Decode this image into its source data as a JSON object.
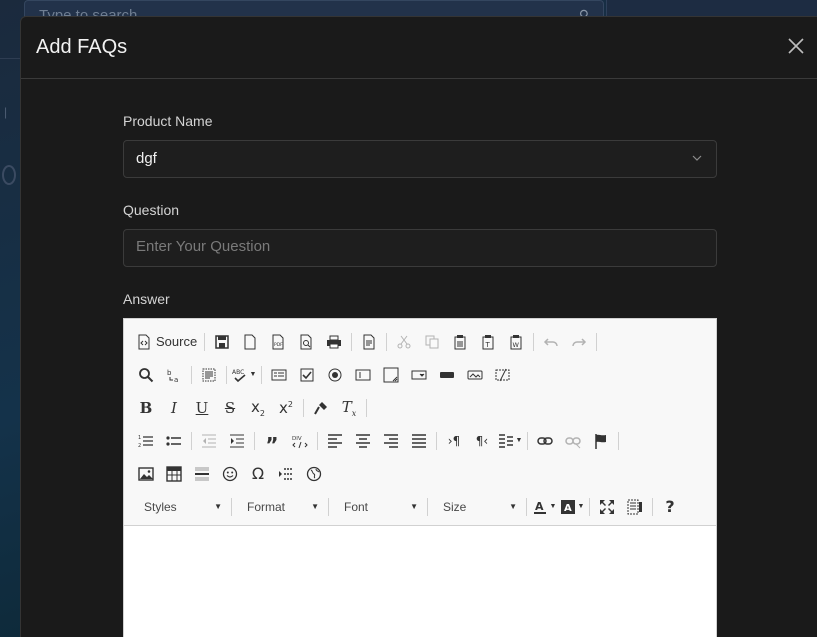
{
  "background": {
    "search_placeholder": "Type to search"
  },
  "modal": {
    "title": "Add FAQs",
    "close_symbol": "×"
  },
  "form": {
    "product_label": "Product Name",
    "product_value": "dgf",
    "question_label": "Question",
    "question_placeholder": "Enter Your Question",
    "answer_label": "Answer"
  },
  "editor": {
    "source_label": "Source",
    "combos": {
      "styles": "Styles",
      "format": "Format",
      "font": "Font",
      "size": "Size"
    },
    "toolbar_icons": [
      [
        "source-icon",
        "save-icon",
        "new-page-icon",
        "export-pdf-icon",
        "preview-icon",
        "print-icon",
        "templates-icon",
        "cut-icon",
        "copy-icon",
        "paste-icon",
        "paste-text-icon",
        "paste-word-icon",
        "undo-icon",
        "redo-icon"
      ],
      [
        "find-icon",
        "replace-icon",
        "select-all-icon",
        "spellcheck-icon",
        "form-icon",
        "checkbox-icon",
        "radio-icon",
        "textfield-icon",
        "textarea-icon",
        "select-icon",
        "button-icon",
        "image-button-icon",
        "hidden-field-icon"
      ],
      [
        "bold-icon",
        "italic-icon",
        "underline-icon",
        "strike-icon",
        "subscript-icon",
        "superscript-icon",
        "copy-format-icon",
        "remove-format-icon"
      ],
      [
        "numbered-list-icon",
        "bulleted-list-icon",
        "outdent-icon",
        "indent-icon",
        "blockquote-icon",
        "div-icon",
        "align-left-icon",
        "align-center-icon",
        "align-right-icon",
        "justify-icon",
        "ltr-icon",
        "rtl-icon",
        "language-icon",
        "link-icon",
        "unlink-icon",
        "anchor-icon"
      ],
      [
        "image-icon",
        "table-icon",
        "horizontal-line-icon",
        "smiley-icon",
        "special-char-icon",
        "page-break-icon",
        "iframe-icon"
      ],
      [
        "text-color-icon",
        "bg-color-icon",
        "maximize-icon",
        "show-blocks-icon",
        "about-icon"
      ]
    ]
  },
  "colors": {
    "modal_bg": "#1a1a1a",
    "field_border": "#3b3b3b",
    "toolbar_bg": "#f8f8f8"
  }
}
